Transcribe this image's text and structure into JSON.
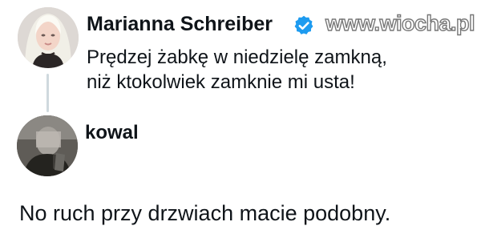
{
  "tweet": {
    "author_name": "Marianna Schreiber",
    "verified_icon": "verified-badge-icon",
    "text_lines": [
      "Prędzej żabkę w niedzielę zamkną,",
      "niż ktokolwiek zamknie mi usta!"
    ]
  },
  "reply": {
    "author_name": "kowal",
    "text": "No ruch przy drzwiach macie podobny."
  },
  "watermark": {
    "text": "www.wiocha.pl"
  },
  "colors": {
    "text": "#0f1419",
    "verified": "#1d9bf0",
    "thread_line": "#cfd9de"
  }
}
